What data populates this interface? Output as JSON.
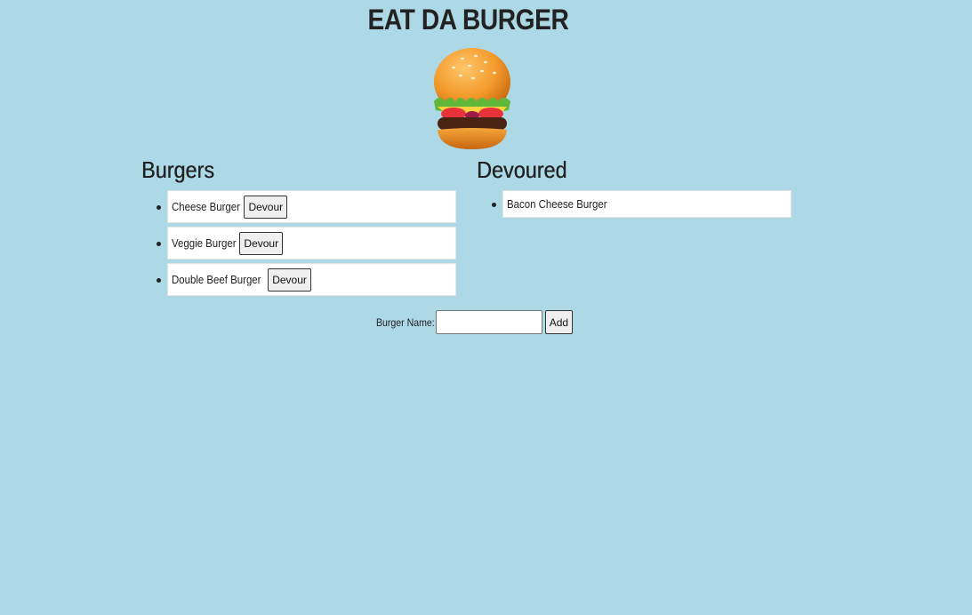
{
  "header": {
    "title": "EAT DA BURGER"
  },
  "images": {
    "burger": "burger-icon"
  },
  "burgers": {
    "heading": "Burgers",
    "items": [
      {
        "name": "Cheese Burger",
        "button": "Devour"
      },
      {
        "name": "Veggie Burger",
        "button": "Devour"
      },
      {
        "name": "Double Beef Burger",
        "button": "Devour"
      }
    ]
  },
  "devoured": {
    "heading": "Devoured",
    "items": [
      {
        "name": "Bacon Cheese Burger"
      }
    ]
  },
  "form": {
    "label": "Burger Name:",
    "input_value": "",
    "add_label": "Add"
  },
  "colors": {
    "background": "#add8e6",
    "item_background": "#ffffff"
  }
}
